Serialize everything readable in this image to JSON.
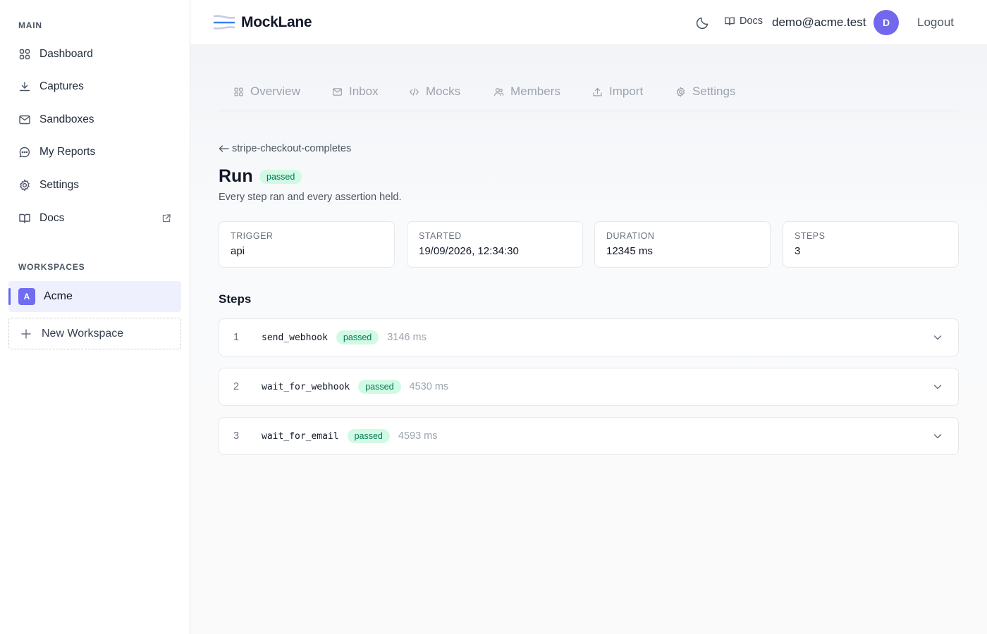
{
  "sidebar": {
    "main_label": "MAIN",
    "items": [
      {
        "label": "Dashboard",
        "icon": "grid-icon"
      },
      {
        "label": "Captures",
        "icon": "download-icon"
      },
      {
        "label": "Sandboxes",
        "icon": "mail-icon"
      },
      {
        "label": "My Reports",
        "icon": "chat-icon"
      },
      {
        "label": "Settings",
        "icon": "gear-icon"
      },
      {
        "label": "Docs",
        "icon": "book-icon",
        "external": true
      }
    ],
    "workspaces_label": "WORKSPACES",
    "workspace": {
      "initial": "A",
      "name": "Acme"
    },
    "new_workspace_label": "New Workspace"
  },
  "header": {
    "brand": "MockLane",
    "docs_label": "Docs",
    "user_email": "demo@acme.test",
    "avatar_initial": "D",
    "logout_label": "Logout"
  },
  "tabs": [
    {
      "label": "Overview",
      "icon": "grid-icon"
    },
    {
      "label": "Inbox",
      "icon": "mail-icon"
    },
    {
      "label": "Mocks",
      "icon": "code-icon"
    },
    {
      "label": "Members",
      "icon": "users-icon"
    },
    {
      "label": "Import",
      "icon": "upload-icon"
    },
    {
      "label": "Settings",
      "icon": "gear-icon"
    }
  ],
  "run": {
    "back_label": "stripe-checkout-completes",
    "title": "Run",
    "status": "passed",
    "description": "Every step ran and every assertion held.",
    "stats": [
      {
        "label": "TRIGGER",
        "value": "api"
      },
      {
        "label": "STARTED",
        "value": "19/09/2026, 12:34:30"
      },
      {
        "label": "DURATION",
        "value": "12345 ms"
      },
      {
        "label": "STEPS",
        "value": "3"
      }
    ]
  },
  "steps_heading": "Steps",
  "steps": [
    {
      "num": "1",
      "name": "send_webhook",
      "status": "passed",
      "duration": "3146 ms"
    },
    {
      "num": "2",
      "name": "wait_for_webhook",
      "status": "passed",
      "duration": "4530 ms"
    },
    {
      "num": "3",
      "name": "wait_for_email",
      "status": "passed",
      "duration": "4593 ms"
    }
  ],
  "colors": {
    "accent": "#6366f1",
    "avatar": "#7268ee",
    "success_bg": "#d1fae5",
    "success_text": "#047857"
  }
}
